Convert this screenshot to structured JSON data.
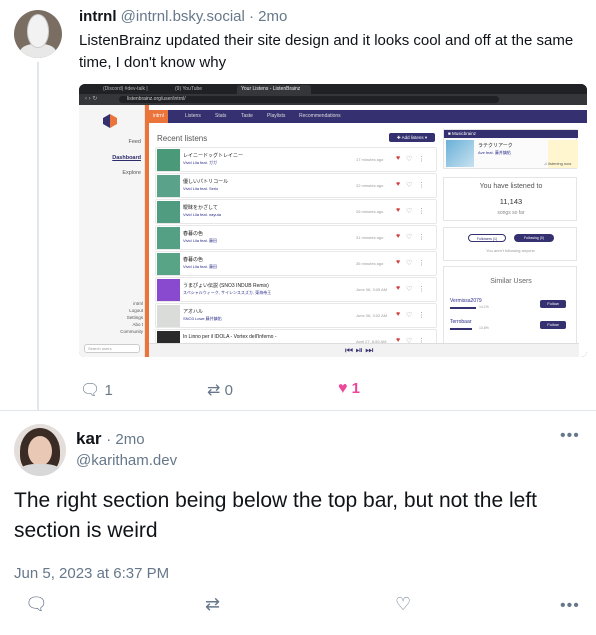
{
  "post1": {
    "display_name": "intrnl",
    "handle": "@intrnl.bsky.social",
    "separator": "·",
    "time": "2mo",
    "text": "ListenBrainz updated their site design and it looks cool and off at the same time, I don't know why",
    "reply_count": "1",
    "repost_count": "0",
    "like_count": "1",
    "like_color": "#ec4899",
    "icons": {
      "reply": "reply-icon",
      "repost": "repost-icon",
      "like": "heart-icon"
    }
  },
  "screenshot": {
    "tabs": [
      "(Discord) #dev-talk | Mangaloo",
      "(9) YouTube",
      "Your Listens - ListenBrainz"
    ],
    "url": "listenbrainz.org/user/intrnl/",
    "sidebar": {
      "items": [
        "Feed",
        "Dashboard",
        "Explore"
      ],
      "footer_items": [
        "intrnl",
        "Logout",
        "Settings",
        "Abo t",
        "Community"
      ],
      "search_placeholder": "Search users"
    },
    "top_tabs": [
      "intrnl",
      "Listens",
      "Stats",
      "Taste",
      "Playlists",
      "Recommendations"
    ],
    "recent_listens_title": "Recent listens",
    "add_listens_label": "✚ Add listens ▾",
    "listens": [
      {
        "title": "レイニードッグトレイニー",
        "artist": "Vivid Lila feat. ガガ",
        "ago": "17 minutes ago",
        "cover": "#4a9a7a"
      },
      {
        "title": "優しいパトリコール",
        "artist": "Vivid Lila feat. Serio",
        "ago": "22 minutes ago",
        "cover": "#5aa28a"
      },
      {
        "title": "曖昧をかざして",
        "artist": "Vivid Lila feat. nayuta",
        "ago": "26 minutes ago",
        "cover": "#4f9c80"
      },
      {
        "title": "春暮の色",
        "artist": "Vivid Lila feat. 藤田",
        "ago": "31 minutes ago",
        "cover": "#54a084"
      },
      {
        "title": "春暮の色",
        "artist": "Vivid Lila feat. 藤田",
        "ago": "35 minutes ago",
        "cover": "#57a487"
      },
      {
        "title": "うまぴょい伝説 (SNO3 INDUB Remix)",
        "artist": "スペシャルウィーク, サイレンススズカ, 東海帝王",
        "ago": "June 06, 3:05 AM",
        "cover": "#8a4ad0"
      },
      {
        "title": "アオハル",
        "artist": "SNO3 Lowe 藤井鎮佑",
        "ago": "June 06, 3:02 AM",
        "cover": "#d9dcd8"
      },
      {
        "title": "In Linno per il IDOLA - Vortex dell'Inferno -",
        "artist": "cold(S/N)",
        "ago": "April 27, 8:59 AM",
        "cover": "#2a2a2a"
      }
    ],
    "now_playing_label": "■ Musicbrainz",
    "now_playing_title": "ラテクリアーク",
    "now_playing_sub": "Ave feat. 藤井鎮佑",
    "now_playing_status": "♫ listening now",
    "listened_label": "You have listened to",
    "listen_count": "11,143",
    "songs_label": "songs so far",
    "followers_pill": "Followers (1)",
    "following_pill": "Following (0)",
    "follow_note": "You aren't following anyone.",
    "similar_title": "Similar Users",
    "similar_users": [
      {
        "name": "Vermissa2079",
        "pct": "14.1%"
      },
      {
        "name": "Terrobaar",
        "pct": "13.8%"
      }
    ],
    "follow_label": "Follow",
    "player_controls": "⏮ ⏯ ⏭"
  },
  "post2": {
    "display_name": "kar",
    "time": "· 2mo",
    "handle": "@karitham.dev",
    "text": "The right section being below the top bar, but not the left section is weird",
    "date": "Jun 5, 2023 at 6:37 PM",
    "icons": {
      "reply": "reply-icon",
      "repost": "repost-icon",
      "like": "heart-icon",
      "more": "more-icon"
    }
  },
  "colors": {
    "lb_purple": "#353070",
    "lb_orange": "#eb743b",
    "muted_text": "#66788a"
  }
}
